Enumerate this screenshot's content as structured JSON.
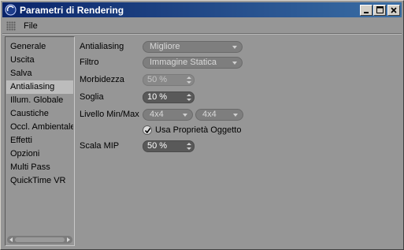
{
  "window": {
    "title": "Parametri di Rendering"
  },
  "menu": {
    "file_label": "File"
  },
  "sidebar": {
    "items": [
      {
        "label": "Generale",
        "selected": false
      },
      {
        "label": "Uscita",
        "selected": false
      },
      {
        "label": "Salva",
        "selected": false
      },
      {
        "label": "Antialiasing",
        "selected": true
      },
      {
        "label": "Illum. Globale",
        "selected": false
      },
      {
        "label": "Caustiche",
        "selected": false
      },
      {
        "label": "Occl. Ambientale",
        "selected": false
      },
      {
        "label": "Effetti",
        "selected": false
      },
      {
        "label": "Opzioni",
        "selected": false
      },
      {
        "label": "Multi Pass",
        "selected": false
      },
      {
        "label": "QuickTime VR",
        "selected": false
      }
    ]
  },
  "settings": {
    "antialiasing": {
      "label": "Antialiasing",
      "value": "Migliore"
    },
    "filtro": {
      "label": "Filtro",
      "value": "Immagine Statica"
    },
    "morbidezza": {
      "label": "Morbidezza",
      "value": "50 %",
      "enabled": false
    },
    "soglia": {
      "label": "Soglia",
      "value": "10 %"
    },
    "livello": {
      "label": "Livello Min/Max",
      "min": "4x4",
      "max": "4x4"
    },
    "usa_proprieta": {
      "label": "Usa Proprietà Oggetto",
      "checked": true
    },
    "scala_mip": {
      "label": "Scala MIP",
      "value": "50 %"
    }
  },
  "colors": {
    "titlebar_start": "#0a246a",
    "titlebar_end": "#3a6ea5",
    "background": "#969696",
    "selected_item": "#bcbcbc"
  }
}
